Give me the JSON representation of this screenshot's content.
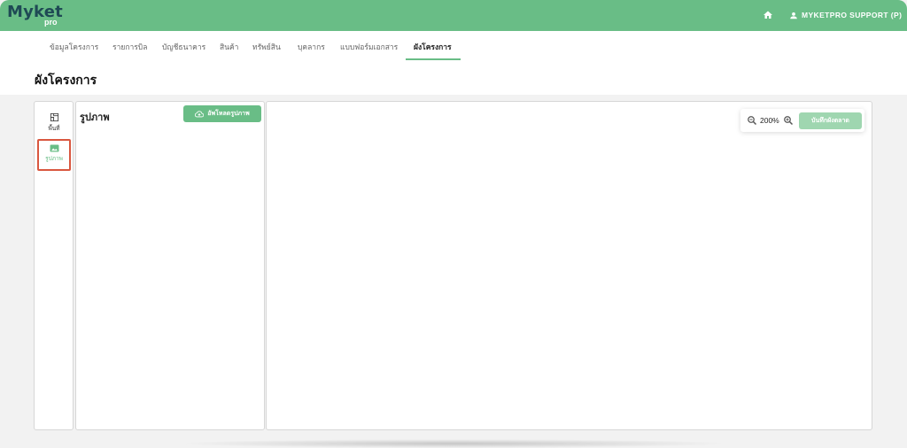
{
  "header": {
    "logo_text": "Myket",
    "logo_sub": "pro",
    "home_icon": "home-icon",
    "user_icon": "user-icon",
    "user_name": "MYKETPRO SUPPORT (P)",
    "background": "#69bd86"
  },
  "tabs": [
    {
      "label": "ข้อมูลโครงการ",
      "active": false
    },
    {
      "label": "รายการบิล",
      "active": false
    },
    {
      "label": "บัญชีธนาคาร",
      "active": false
    },
    {
      "label": "สินค้า",
      "active": false
    },
    {
      "label": "ทรัพย์สิน",
      "active": false
    },
    {
      "label": "บุคลากร",
      "active": false
    },
    {
      "label": "แบบฟอร์มเอกสาร",
      "active": false
    },
    {
      "label": "ผังโครงการ",
      "active": true
    }
  ],
  "page": {
    "title": "ผังโครงการ"
  },
  "sidebar": {
    "items": [
      {
        "label": "พื้นที่",
        "icon": "area-icon",
        "selected": false
      },
      {
        "label": "รูปภาพ",
        "icon": "image-icon",
        "selected": true
      }
    ]
  },
  "images_panel": {
    "title": "รูปภาพ",
    "upload_label": "อัพโหลดรูปภาพ",
    "upload_icon": "cloud-upload-icon"
  },
  "canvas": {
    "zoom": "200%",
    "zoom_out_icon": "zoom-out-icon",
    "zoom_in_icon": "zoom-in-icon",
    "save_label": "บันทึกผังตลาด"
  },
  "colors": {
    "accent": "#69bd86",
    "accent_light": "#9fd6b0",
    "highlight": "#d9573f"
  }
}
